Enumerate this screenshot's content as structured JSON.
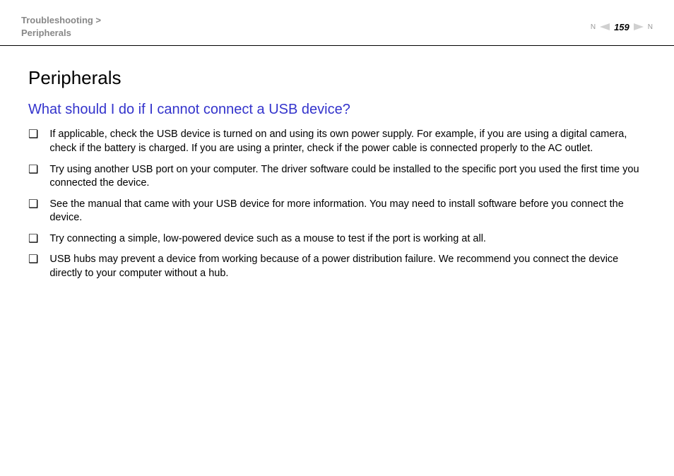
{
  "breadcrumb": {
    "line1": "Troubleshooting >",
    "line2": "Peripherals"
  },
  "pageNumber": "159",
  "nLabel": "N",
  "title": "Peripherals",
  "sectionTitle": "What should I do if I cannot connect a USB device?",
  "bullets": [
    "If applicable, check the USB device is turned on and using its own power supply. For example, if you are using a digital camera, check if the battery is charged. If you are using a printer, check if the power cable is connected properly to the AC outlet.",
    "Try using another USB port on your computer. The driver software could be installed to the specific port you used the first time you connected the device.",
    "See the manual that came with your USB device for more information. You may need to install software before you connect the device.",
    "Try connecting a simple, low-powered device such as a mouse to test if the port is working at all.",
    "USB hubs may prevent a device from working because of a power distribution failure. We recommend you connect the device directly to your computer without a hub."
  ]
}
